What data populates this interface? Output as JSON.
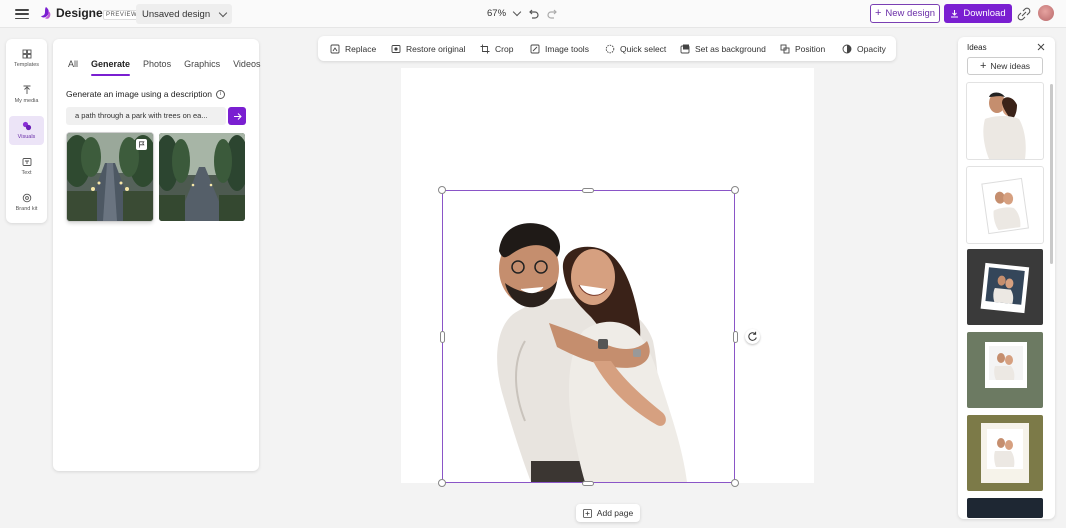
{
  "app": {
    "name": "Designer",
    "preview_badge": "PREVIEW",
    "design_name": "Unsaved design",
    "zoom": "67%",
    "new_design_label": "New design",
    "download_label": "Download"
  },
  "rail": {
    "items": [
      {
        "label": "Templates",
        "icon": "templates-icon"
      },
      {
        "label": "My media",
        "icon": "upload-icon"
      },
      {
        "label": "Visuals",
        "icon": "visuals-icon",
        "active": true
      },
      {
        "label": "Text",
        "icon": "text-icon"
      },
      {
        "label": "Brand kit",
        "icon": "brand-kit-icon"
      }
    ]
  },
  "panel": {
    "tabs": [
      "All",
      "Generate",
      "Photos",
      "Graphics",
      "Videos"
    ],
    "active_tab": "Generate",
    "generate_title": "Generate an image using a description",
    "prompt_value": "a path through a park with trees on ea...",
    "results_count": 2
  },
  "toolbar": {
    "items": [
      {
        "label": "Replace",
        "icon": "replace-icon"
      },
      {
        "label": "Restore original",
        "icon": "restore-icon"
      },
      {
        "label": "Crop",
        "icon": "crop-icon"
      },
      {
        "label": "Image tools",
        "icon": "image-tools-icon"
      },
      {
        "label": "Quick select",
        "icon": "quick-select-icon"
      },
      {
        "label": "Set as background",
        "icon": "set-background-icon"
      },
      {
        "label": "Position",
        "icon": "position-icon"
      },
      {
        "label": "Opacity",
        "icon": "opacity-icon"
      }
    ]
  },
  "canvas": {
    "add_page_label": "Add page"
  },
  "ideas": {
    "title": "Ideas",
    "new_ideas_label": "New ideas"
  },
  "colors": {
    "accent": "#7a1fd1",
    "selection": "#8a55c7"
  }
}
